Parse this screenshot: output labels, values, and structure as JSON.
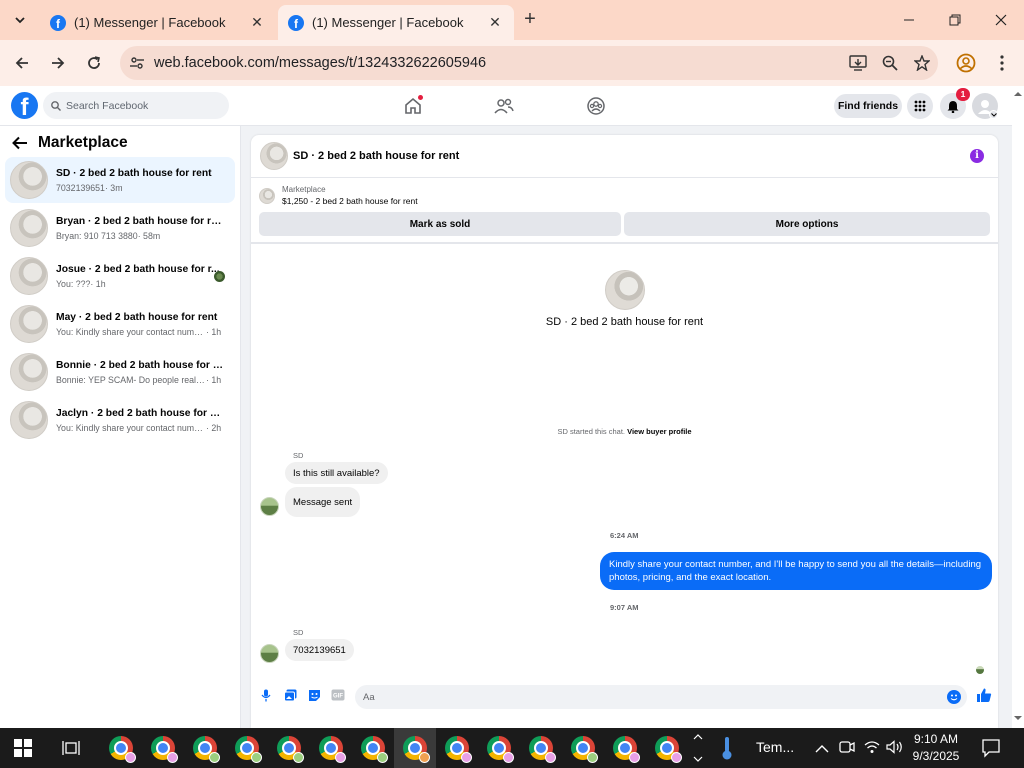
{
  "browser": {
    "tabs": [
      {
        "title": "(1) Messenger | Facebook",
        "active": false
      },
      {
        "title": "(1) Messenger | Facebook",
        "active": true
      }
    ],
    "url": "web.facebook.com/messages/t/1324332622605946"
  },
  "fb_header": {
    "search_placeholder": "Search Facebook",
    "find_friends": "Find friends",
    "notification_count": "1"
  },
  "sidebar": {
    "title": "Marketplace",
    "conversations": [
      {
        "name": "SD · 2 bed 2 bath house for rent",
        "preview": "7032139651",
        "time": "· 3m"
      },
      {
        "name": "Bryan · 2 bed 2 bath house for rent",
        "preview": "Bryan: 910 713 3880",
        "time": "· 58m"
      },
      {
        "name": "Josue · 2 bed 2 bath house for r...",
        "preview": "You: ???",
        "time": "· 1h"
      },
      {
        "name": "May · 2 bed 2 bath house for rent",
        "preview": "You: Kindly share your contact numbe...",
        "time": "· 1h"
      },
      {
        "name": "Bonnie · 2 bed 2 bath house for rent",
        "preview": "Bonnie: YEP SCAM- Do people really f...",
        "time": "· 1h"
      },
      {
        "name": "Jaclyn · 2 bed 2 bath house for rent",
        "preview": "You: Kindly share your contact numbe...",
        "time": "· 2h"
      }
    ]
  },
  "chat": {
    "title": "SD · 2 bed 2 bath house for rent",
    "marketplace_label": "Marketplace",
    "listing": "$1,250 - 2 bed 2 bath house for rent",
    "mark_sold": "Mark as sold",
    "more_options": "More options",
    "intro_name": "SD · 2 bed 2 bath house for rent",
    "started_text": "SD started this chat. ",
    "view_profile": "View buyer profile",
    "messages": {
      "sender1": "SD",
      "m1": "Is this still available?",
      "m2": "Message sent",
      "time1": "6:24 AM",
      "out1": "Kindly share your contact number, and I'll be happy to send you all the details—including photos, pricing, and the exact location.",
      "time2": "9:07 AM",
      "sender2": "SD",
      "m3": "7032139651"
    },
    "composer_placeholder": "Aa"
  },
  "taskbar": {
    "weather": "Tem...",
    "time": "9:10 AM",
    "date": "9/3/2025"
  }
}
